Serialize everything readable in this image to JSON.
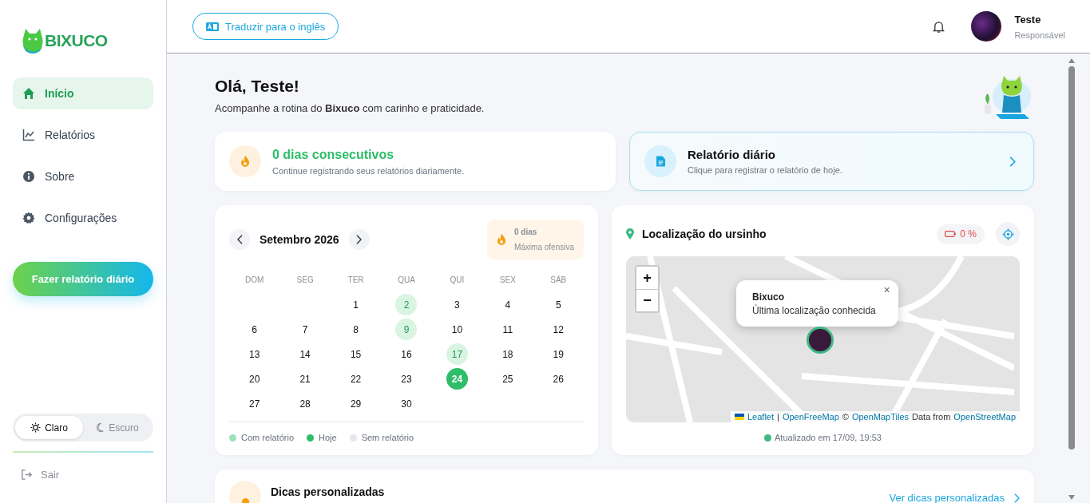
{
  "sidebar": {
    "logo": "BIXUCO",
    "items": [
      {
        "label": "Início",
        "selected": true
      },
      {
        "label": "Relatórios",
        "selected": false
      },
      {
        "label": "Sobre",
        "selected": false
      },
      {
        "label": "Configurações",
        "selected": false
      }
    ],
    "action_button": "Fazer relatório diário",
    "theme_options": [
      {
        "label": "Claro",
        "selected": true
      },
      {
        "label": "Escuro",
        "selected": false
      }
    ],
    "logout": "Sair"
  },
  "header": {
    "translate_button": "Traduzir para o inglês",
    "user": {
      "name": "Teste",
      "role": "Responsável"
    }
  },
  "greeting": {
    "title": "Olá, Teste!",
    "subtitle": "Acompanhe a rotina do **Bixuco** com carinho e praticidade."
  },
  "streak_card": {
    "title": "0 dias consecutivos",
    "subtitle": "Continue registrando seus relatórios diariamente."
  },
  "report_card": {
    "title": "Relatório diário",
    "subtitle": "Clique para registrar o relatório de hoje."
  },
  "calendar": {
    "month": "Setembro 2026",
    "best_streak": {
      "value": "0 dias",
      "label": "Máxima ofensiva"
    },
    "weekdays": [
      "DOM",
      "SEG",
      "TER",
      "QUA",
      "QUI",
      "SEX",
      "SÁB"
    ],
    "days": [
      {
        "kind": "blank"
      },
      {
        "kind": "blank"
      },
      {
        "kind": "day",
        "label": "1",
        "has_report": false,
        "today": false
      },
      {
        "kind": "day",
        "label": "2",
        "has_report": true,
        "today": false
      },
      {
        "kind": "day",
        "label": "3",
        "has_report": false,
        "today": false
      },
      {
        "kind": "day",
        "label": "4",
        "has_report": false,
        "today": false
      },
      {
        "kind": "day",
        "label": "5",
        "has_report": false,
        "today": false
      },
      {
        "kind": "day",
        "label": "6",
        "has_report": false,
        "today": false
      },
      {
        "kind": "day",
        "label": "7",
        "has_report": false,
        "today": false
      },
      {
        "kind": "day",
        "label": "8",
        "has_report": false,
        "today": false
      },
      {
        "kind": "day",
        "label": "9",
        "has_report": true,
        "today": false
      },
      {
        "kind": "day",
        "label": "10",
        "has_report": false,
        "today": false
      },
      {
        "kind": "day",
        "label": "11",
        "has_report": false,
        "today": false
      },
      {
        "kind": "day",
        "label": "12",
        "has_report": false,
        "today": false
      },
      {
        "kind": "day",
        "label": "13",
        "has_report": false,
        "today": false
      },
      {
        "kind": "day",
        "label": "14",
        "has_report": false,
        "today": false
      },
      {
        "kind": "day",
        "label": "15",
        "has_report": false,
        "today": false
      },
      {
        "kind": "day",
        "label": "16",
        "has_report": false,
        "today": false
      },
      {
        "kind": "day",
        "label": "17",
        "has_report": true,
        "today": false
      },
      {
        "kind": "day",
        "label": "18",
        "has_report": false,
        "today": false
      },
      {
        "kind": "day",
        "label": "19",
        "has_report": false,
        "today": false
      },
      {
        "kind": "day",
        "label": "20",
        "has_report": false,
        "today": false
      },
      {
        "kind": "day",
        "label": "21",
        "has_report": false,
        "today": false
      },
      {
        "kind": "day",
        "label": "22",
        "has_report": false,
        "today": false
      },
      {
        "kind": "day",
        "label": "23",
        "has_report": false,
        "today": false
      },
      {
        "kind": "day",
        "label": "24",
        "has_report": false,
        "today": true
      },
      {
        "kind": "day",
        "label": "25",
        "has_report": false,
        "today": false
      },
      {
        "kind": "day",
        "label": "26",
        "has_report": false,
        "today": false
      },
      {
        "kind": "day",
        "label": "27",
        "has_report": false,
        "today": false
      },
      {
        "kind": "day",
        "label": "28",
        "has_report": false,
        "today": false
      },
      {
        "kind": "day",
        "label": "29",
        "has_report": false,
        "today": false
      },
      {
        "kind": "day",
        "label": "30",
        "has_report": false,
        "today": false
      }
    ],
    "legend": [
      {
        "label": "Com relatório",
        "color": "#9ee2bb"
      },
      {
        "label": "Hoje",
        "color": "#2ebd68"
      },
      {
        "label": "Sem relatório",
        "color": "#e5e7eb"
      }
    ]
  },
  "location": {
    "title": "Localização do ursinho",
    "battery": "0 %",
    "zoom_in": "+",
    "zoom_out": "−",
    "popup": {
      "title": "Bixuco",
      "text": "Última localização conhecida",
      "close": "×"
    },
    "attribution": [
      {
        "text": "Leaflet",
        "link": true
      },
      {
        "text": "|",
        "link": false
      },
      {
        "text": "OpenFreeMap",
        "link": true
      },
      {
        "text": "©",
        "link": false
      },
      {
        "text": "OpenMapTiles",
        "link": true
      },
      {
        "text": "Data from",
        "link": false
      },
      {
        "text": "OpenStreetMap",
        "link": true
      }
    ],
    "updated": "Atualizado em 17/09, 19:53"
  },
  "tips_card": {
    "title": "Dicas personalizadas",
    "link": "Ver dicas personalizadas"
  }
}
